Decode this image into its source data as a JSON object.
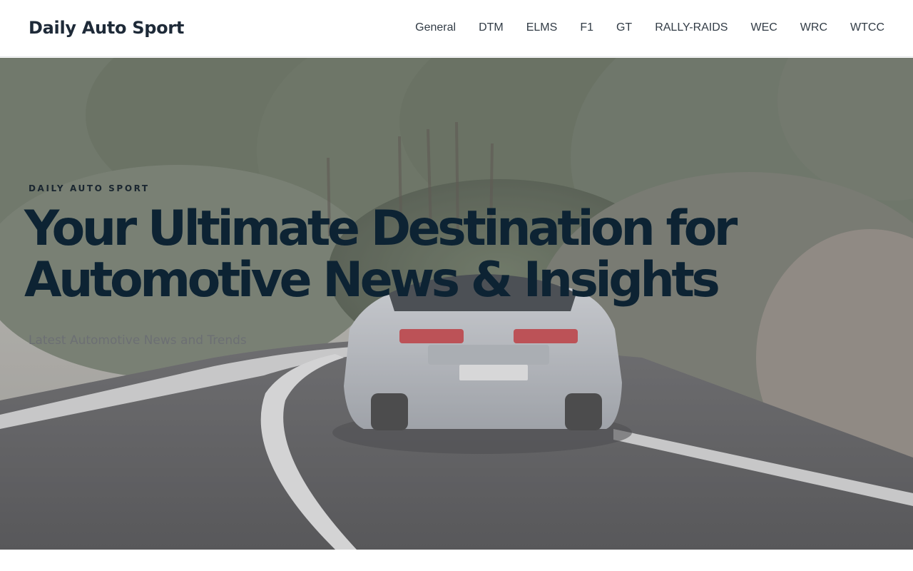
{
  "header": {
    "site_title": "Daily Auto Sport",
    "nav": [
      {
        "label": "General"
      },
      {
        "label": "DTM"
      },
      {
        "label": "ELMS"
      },
      {
        "label": "F1"
      },
      {
        "label": "GT"
      },
      {
        "label": "RALLY-RAIDS"
      },
      {
        "label": "WEC"
      },
      {
        "label": "WRC"
      },
      {
        "label": "WTCC"
      }
    ]
  },
  "hero": {
    "eyebrow": "DAILY AUTO SPORT",
    "headline_line1": "Your Ultimate Destination for",
    "headline_line2": "Automotive News & Insights",
    "subtitle": "Latest Automotive News and Trends",
    "background_image": "silver sports car driving on a curved forest road"
  },
  "colors": {
    "title_text": "#1e2a38",
    "nav_text": "#323c46",
    "headline_text": "#0d2333",
    "subtitle_text": "#6c6f73",
    "hero_overlay": "#a0a0a5"
  }
}
